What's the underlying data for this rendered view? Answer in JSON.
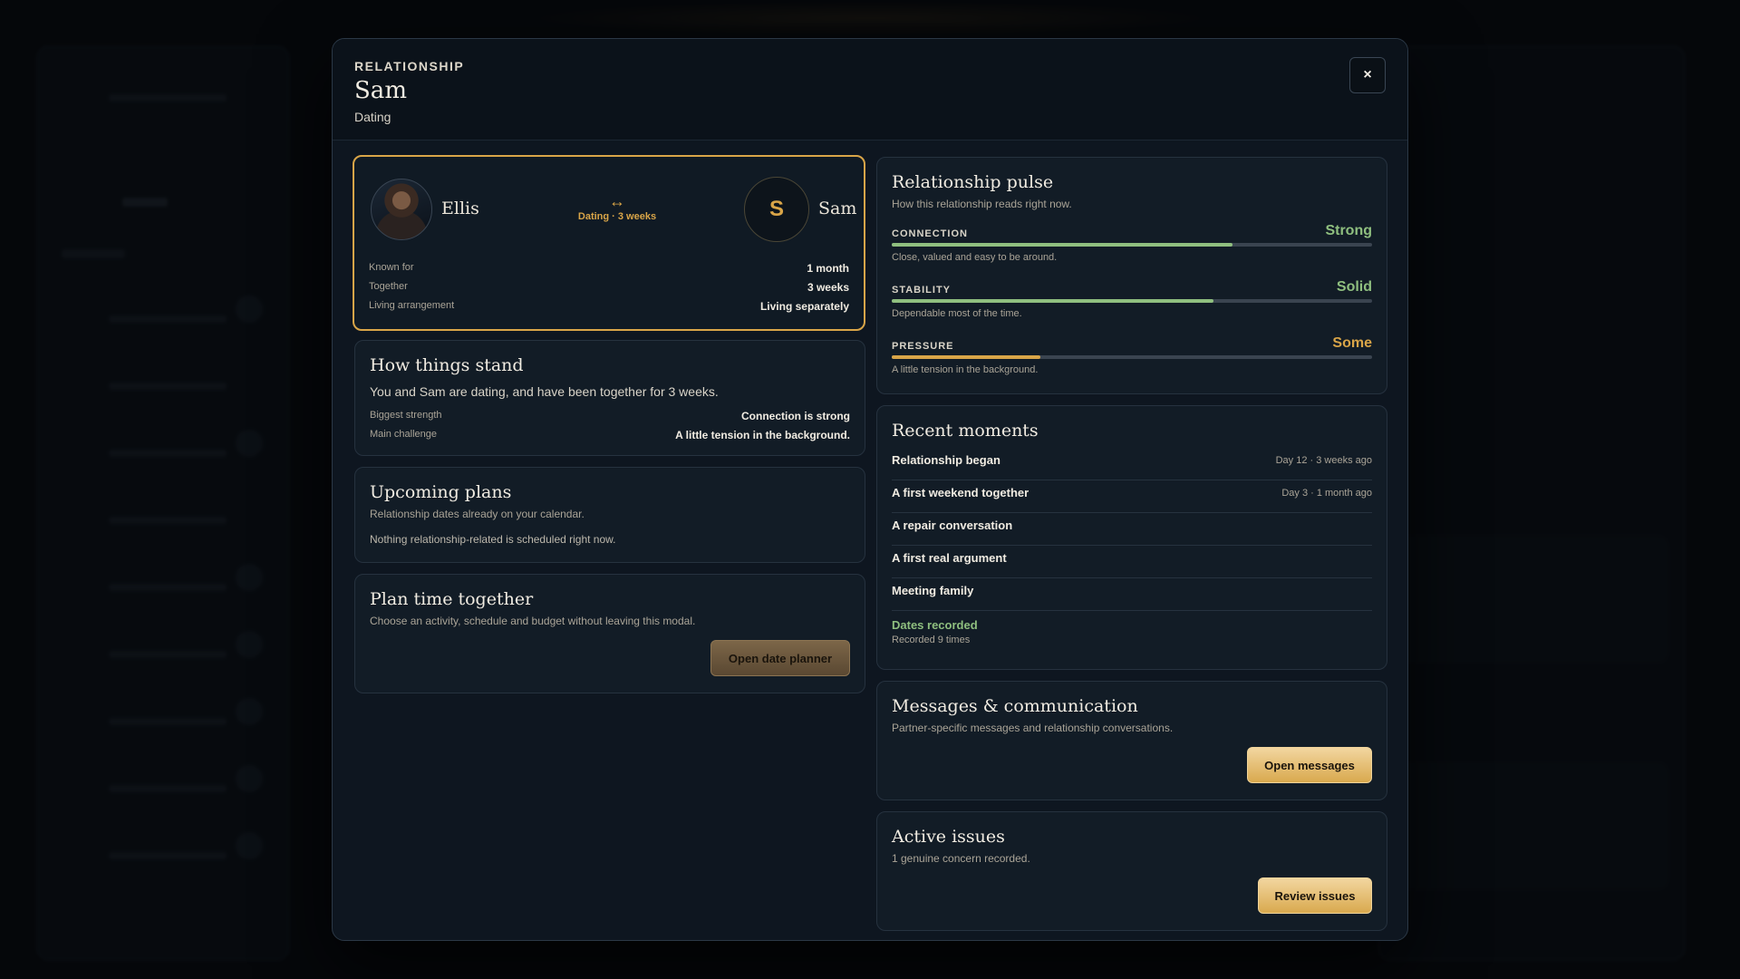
{
  "modal": {
    "eyebrow": "RELATIONSHIP",
    "title": "Sam",
    "subtitle": "Dating",
    "close_icon": "×"
  },
  "couple": {
    "left_name": "Ellis",
    "right_name": "Sam",
    "right_initial": "S",
    "link_icon": "↔",
    "link_text": "Dating · 3 weeks",
    "facts": [
      {
        "label": "Known for",
        "value": "1 month"
      },
      {
        "label": "Together",
        "value": "3 weeks"
      },
      {
        "label": "Living arrangement",
        "value": "Living separately"
      }
    ]
  },
  "stand": {
    "title": "How things stand",
    "text": "You and Sam are dating, and have been together for 3 weeks.",
    "facts": [
      {
        "label": "Biggest strength",
        "value": "Connection is strong"
      },
      {
        "label": "Main challenge",
        "value": "A little tension in the background."
      }
    ]
  },
  "plans": {
    "title": "Upcoming plans",
    "subtitle": "Relationship dates already on your calendar.",
    "empty": "Nothing relationship-related is scheduled right now."
  },
  "plantime": {
    "title": "Plan time together",
    "subtitle": "Choose an activity, schedule and budget without leaving this modal.",
    "button": "Open date planner"
  },
  "pulse": {
    "title": "Relationship pulse",
    "subtitle": "How this relationship reads right now.",
    "metrics": [
      {
        "label": "CONNECTION",
        "value": "Strong",
        "level": 0.71,
        "color": "#8fbf7f",
        "desc": "Close, valued and easy to be around."
      },
      {
        "label": "STABILITY",
        "value": "Solid",
        "level": 0.67,
        "color": "#8fbf7f",
        "desc": "Dependable most of the time."
      },
      {
        "label": "PRESSURE",
        "value": "Some",
        "level": 0.31,
        "color": "#d9a548",
        "desc": "A little tension in the background."
      }
    ]
  },
  "moments": {
    "title": "Recent moments",
    "items": [
      {
        "title": "Relationship began",
        "date": "Day 12 · 3 weeks ago"
      },
      {
        "title": "A first weekend together",
        "date": "Day 3 · 1 month ago"
      },
      {
        "title": "A repair conversation",
        "date": ""
      },
      {
        "title": "A first real argument",
        "date": ""
      },
      {
        "title": "Meeting family",
        "date": ""
      }
    ],
    "dates_label": "Dates recorded",
    "dates_count": "Recorded 9 times"
  },
  "messages": {
    "title": "Messages & communication",
    "subtitle": "Partner-specific messages and relationship conversations.",
    "button": "Open messages"
  },
  "issues": {
    "title": "Active issues",
    "subtitle": "1 genuine concern recorded.",
    "button": "Review issues"
  },
  "colors": {
    "accent": "#d9a548",
    "positive": "#8fbf7f",
    "background": "#05070a",
    "panel": "#0e1620"
  }
}
